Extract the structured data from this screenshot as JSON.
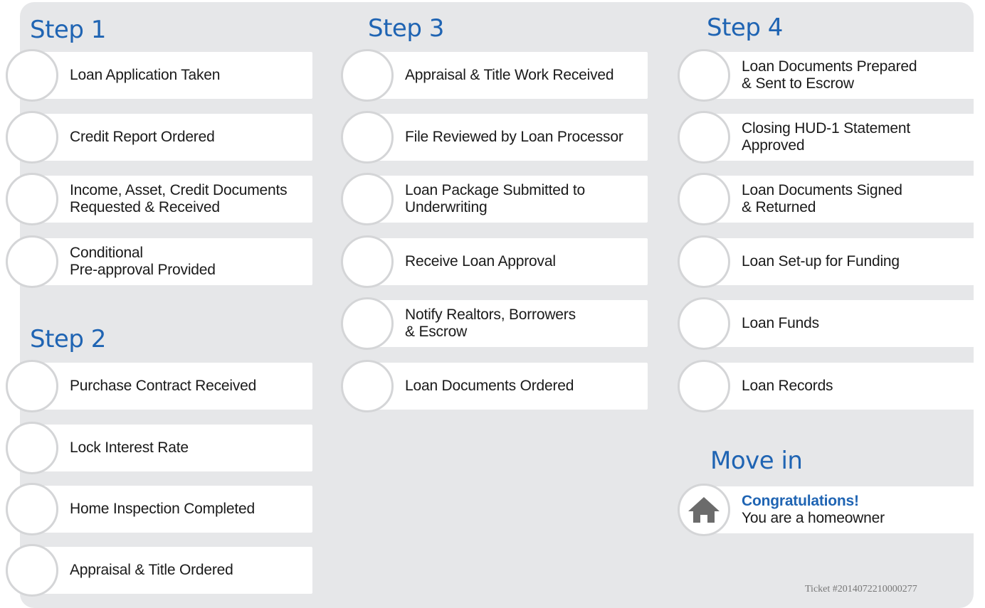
{
  "steps": [
    {
      "title": "Step 1",
      "items": [
        {
          "lines": [
            "Loan Application Taken"
          ]
        },
        {
          "lines": [
            "Credit Report Ordered"
          ]
        },
        {
          "lines": [
            "Income, Asset, Credit Documents",
            "Requested & Received"
          ]
        },
        {
          "lines": [
            "Conditional",
            "Pre-approval Provided"
          ]
        }
      ]
    },
    {
      "title": "Step 2",
      "items": [
        {
          "lines": [
            "Purchase Contract Received"
          ]
        },
        {
          "lines": [
            "Lock Interest Rate"
          ]
        },
        {
          "lines": [
            "Home Inspection Completed"
          ]
        },
        {
          "lines": [
            "Appraisal & Title Ordered"
          ]
        }
      ]
    },
    {
      "title": "Step 3",
      "items": [
        {
          "lines": [
            "Appraisal & Title Work Received"
          ]
        },
        {
          "lines": [
            "File Reviewed by Loan Processor"
          ]
        },
        {
          "lines": [
            "Loan Package Submitted to",
            "Underwriting"
          ]
        },
        {
          "lines": [
            "Receive Loan Approval"
          ]
        },
        {
          "lines": [
            "Notify Realtors, Borrowers",
            "& Escrow"
          ]
        },
        {
          "lines": [
            "Loan Documents Ordered"
          ]
        }
      ]
    },
    {
      "title": "Step 4",
      "items": [
        {
          "lines": [
            "Loan Documents Prepared",
            "& Sent to Escrow"
          ]
        },
        {
          "lines": [
            "Closing HUD-1 Statement",
            "Approved"
          ]
        },
        {
          "lines": [
            "Loan Documents Signed",
            "& Returned"
          ]
        },
        {
          "lines": [
            "Loan Set-up for Funding"
          ]
        },
        {
          "lines": [
            "Loan Funds"
          ]
        },
        {
          "lines": [
            "Loan Records"
          ]
        }
      ]
    }
  ],
  "move_in": {
    "title": "Move in",
    "headline": "Congratulations!",
    "text": "You are a homeowner",
    "icon": "house-icon",
    "icon_color": "#6b6b6b"
  },
  "ticket": "Ticket #2014072210000277",
  "colors": {
    "accent": "#1f64b3",
    "panel": "#e6e7e9"
  }
}
